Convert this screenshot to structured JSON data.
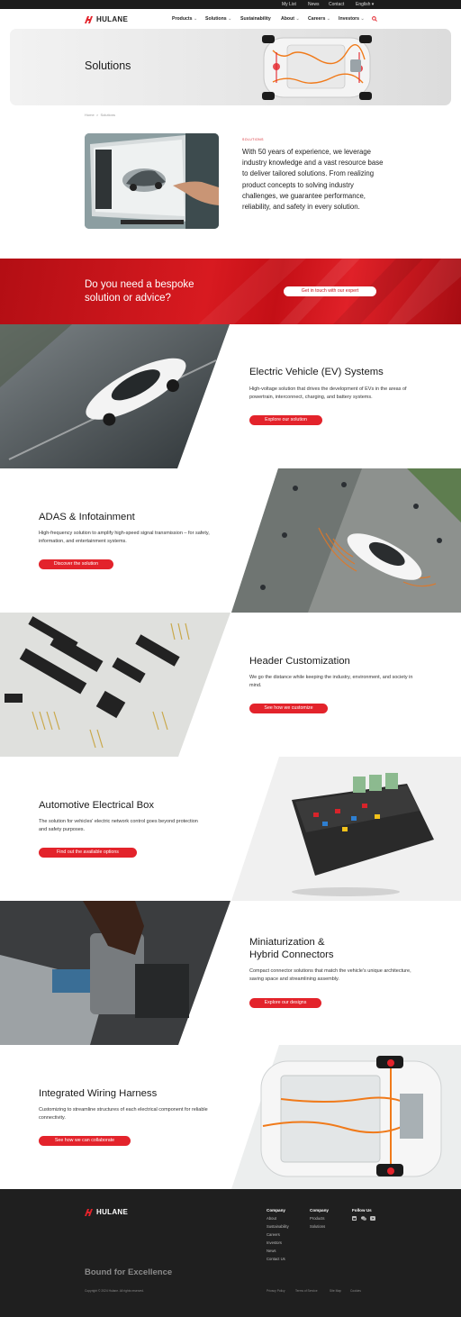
{
  "topbar": {
    "mylist": "My List",
    "news": "News",
    "contact": "Contact",
    "lang": "English"
  },
  "brand": {
    "name": "HULANE",
    "accent": "#e3232b",
    "dark": "#1f1f1f"
  },
  "nav": {
    "items": [
      "Products",
      "Solutions",
      "Sustainability",
      "About",
      "Careers",
      "Investors"
    ]
  },
  "hero": {
    "title": "Solutions"
  },
  "breadcrumb": {
    "home": "Home",
    "current": "Solutions"
  },
  "intro": {
    "eyebrow": "SOLUTIONS",
    "text": "With 50 years of experience, we leverage industry knowledge and a vast resource base to deliver tailored solutions. From realizing product concepts to solving industry challenges, we guarantee performance, reliability, and safety in every solution."
  },
  "banner": {
    "question_line1": "Do you need a bespoke",
    "question_line2": "solution or advice?",
    "button": "Get in touch with our expert"
  },
  "solutions": [
    {
      "title": "Electric Vehicle (EV) Systems",
      "desc": "High-voltage solution that drives the development of EVs in the areas of powertrain, interconnect, charging, and battery systems.",
      "button": "Explore our solution"
    },
    {
      "title": "ADAS & Infotainment",
      "desc": "High-frequency solution to amplify high-speed signal transmission – for safety, information, and entertainment systems.",
      "button": "Discover the solution"
    },
    {
      "title": "Header Customization",
      "desc": "We go the distance while keeping the industry, environment, and society in mind.",
      "button": "See how we customize"
    },
    {
      "title": "Automotive Electrical Box",
      "desc": "The solution for vehicles' electric network control goes beyond protection and safety purposes.",
      "button": "Find out the available options"
    },
    {
      "title_line1": "Miniaturization &",
      "title_line2": "Hybrid Connectors",
      "desc": "Compact connector solutions that match the vehicle's unique architecture, saving space and streamlining assembly.",
      "button": "Explore our designs"
    },
    {
      "title": "Integrated Wiring Harness",
      "desc": "Customizing to streamline structures of each electrical component for reliable connectivity.",
      "button": "See how we can collaborate"
    }
  ],
  "footer": {
    "col1_title": "Company",
    "col1": [
      "About",
      "Sustainability",
      "Careers",
      "Investors",
      "News",
      "Contact Us"
    ],
    "col2_title": "Company",
    "col2": [
      "Products",
      "Solutions"
    ],
    "col3_title": "Follow Us",
    "tagline": "Bound for Excellence",
    "copyright": "Copyright © 2024 Hulane. All rights reserved.",
    "legal": [
      "Privacy Policy",
      "Terms of Service",
      "Site Map",
      "Cookies"
    ]
  }
}
